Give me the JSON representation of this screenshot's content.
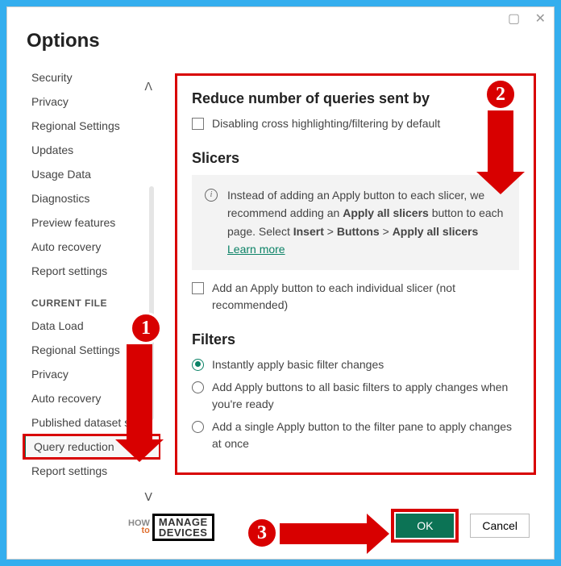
{
  "dialog": {
    "title": "Options"
  },
  "sidebar": {
    "group1": [
      "Security",
      "Privacy",
      "Regional Settings",
      "Updates",
      "Usage Data",
      "Diagnostics",
      "Preview features",
      "Auto recovery",
      "Report settings"
    ],
    "header2": "CURRENT FILE",
    "group2": [
      "Data Load",
      "Regional Settings",
      "Privacy",
      "Auto recovery",
      "Published dataset set...",
      "Query reduction",
      "Report settings"
    ],
    "selected": "Query reduction"
  },
  "main": {
    "reduce": {
      "title": "Reduce number of queries sent by",
      "chk1": "Disabling cross highlighting/filtering by default"
    },
    "slicers": {
      "title": "Slicers",
      "info_pre": "Instead of adding an Apply button to each slicer, we recommend adding an ",
      "info_bold1": "Apply all slicers",
      "info_mid": " button to each page. Select ",
      "info_b2": "Insert",
      "gt1": " > ",
      "info_b3": "Buttons",
      "gt2": " > ",
      "info_b4": "Apply all slicers",
      "learn": "Learn more",
      "chk2": "Add an Apply button to each individual slicer (not recommended)"
    },
    "filters": {
      "title": "Filters",
      "r1": "Instantly apply basic filter changes",
      "r2": "Add Apply buttons to all basic filters to apply changes when you're ready",
      "r3": "Add a single Apply button to the filter pane to apply changes at once"
    }
  },
  "footer": {
    "ok": "OK",
    "cancel": "Cancel"
  },
  "annot": {
    "b1": "1",
    "b2": "2",
    "b3": "3",
    "wm_how": "HOW",
    "wm_to": "to",
    "wm_m": "MANAGE",
    "wm_d": "DEVICES"
  }
}
